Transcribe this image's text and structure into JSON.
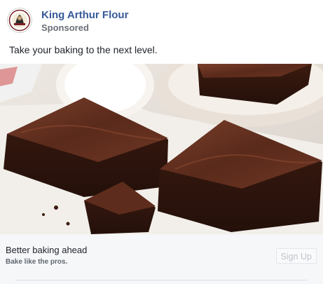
{
  "post": {
    "page_name": "King Arthur Flour",
    "sponsored_label": "Sponsored",
    "text": "Take your baking to the next level.",
    "avatar_icon": "king-arthur-logo-icon",
    "media_image": "brownies-photo"
  },
  "link_card": {
    "headline": "Better baking ahead",
    "description": "Bake like the pros.",
    "cta_label": "Sign Up"
  },
  "colors": {
    "page_name": "#365899",
    "card_background": "#f6f7f9",
    "brownie": "#4a2418"
  }
}
